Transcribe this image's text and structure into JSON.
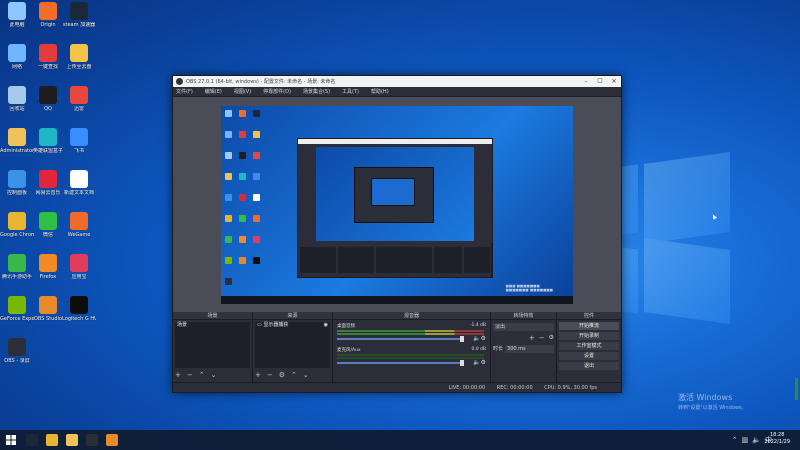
{
  "desktop": {
    "icons": [
      {
        "label": "此电脑",
        "color": "#8ec6ff"
      },
      {
        "label": "Origin",
        "color": "#f26c2a"
      },
      {
        "label": "steam 加速器",
        "color": "#1b2838"
      },
      {
        "label": "网络",
        "color": "#6fb6ff"
      },
      {
        "label": "一键查找",
        "color": "#e23c3c"
      },
      {
        "label": "上传至云盘",
        "color": "#f3c34a"
      },
      {
        "label": "回收站",
        "color": "#a7c9e8"
      },
      {
        "label": "QQ",
        "color": "#1d1d1d"
      },
      {
        "label": "迅雷",
        "color": "#e8473b"
      },
      {
        "label": "Administrator",
        "color": "#f0c35a"
      },
      {
        "label": "英雄联盟盒子",
        "color": "#1db7c8"
      },
      {
        "label": "飞书",
        "color": "#3a8dff"
      },
      {
        "label": "控制面板",
        "color": "#3a92e8"
      },
      {
        "label": "网易云音乐",
        "color": "#e0263a"
      },
      {
        "label": "新建文本文档",
        "color": "#ffffff"
      },
      {
        "label": "Google Chrome",
        "color": "#e8b530"
      },
      {
        "label": "微信",
        "color": "#2fbf44"
      },
      {
        "label": "WeGame",
        "color": "#f06b2a"
      },
      {
        "label": "腾讯手游助手",
        "color": "#37b84a"
      },
      {
        "label": "Firefox",
        "color": "#f28b23"
      },
      {
        "label": "应用宝",
        "color": "#e23c5c"
      },
      {
        "label": "GeForce Experience",
        "color": "#76b900"
      },
      {
        "label": "OBS Studio",
        "color": "#e88a2a"
      },
      {
        "label": "Logitech G HUB",
        "color": "#0d0d0d"
      },
      {
        "label": "OBS - 录屏",
        "color": "#2b2e38"
      }
    ]
  },
  "obs": {
    "title": "OBS 27.0.1 (64-bit, windows) - 配置文件: 未命名 - 场景: 未命名",
    "menu": [
      "文件(F)",
      "编辑(E)",
      "视图(V)",
      "停靠部件(D)",
      "场景集合(S)",
      "工具(T)",
      "帮助(H)"
    ],
    "docks": {
      "scenes": {
        "title": "场景",
        "items": [
          "场景"
        ]
      },
      "sources": {
        "title": "来源",
        "items": [
          "显示器捕获"
        ]
      },
      "mixer": {
        "title": "混音器",
        "channels": [
          {
            "name": "桌面音频",
            "db": "-1.4 dB"
          },
          {
            "name": "麦克风/Aux",
            "db": "0.0 dB"
          }
        ]
      },
      "transitions": {
        "title": "转场特效",
        "type": "淡出",
        "duration_label": "时长",
        "duration": "300 ms"
      },
      "controls": {
        "title": "控件",
        "buttons": [
          "开始推流",
          "开始录制",
          "工作室模式",
          "设置",
          "退出"
        ]
      }
    },
    "status": {
      "live": "LIVE: 00:00:00",
      "rec": "REC: 00:00:00",
      "cpu": "CPU: 0.9%, 30.00 fps"
    }
  },
  "activation": {
    "line1": "激活 Windows",
    "line2": "转到\"设置\"以激活 Windows。"
  },
  "taskbar": {
    "apps": [
      {
        "name": "steam",
        "color": "#1b2838"
      },
      {
        "name": "chrome",
        "color": "#e8b530"
      },
      {
        "name": "file-explorer",
        "color": "#f0c35a"
      },
      {
        "name": "obs",
        "color": "#2b2e38"
      },
      {
        "name": "wegame",
        "color": "#e88a2a"
      }
    ],
    "clock_time": "18:28",
    "clock_date": "2022/1/29",
    "tray_lang": "中"
  }
}
